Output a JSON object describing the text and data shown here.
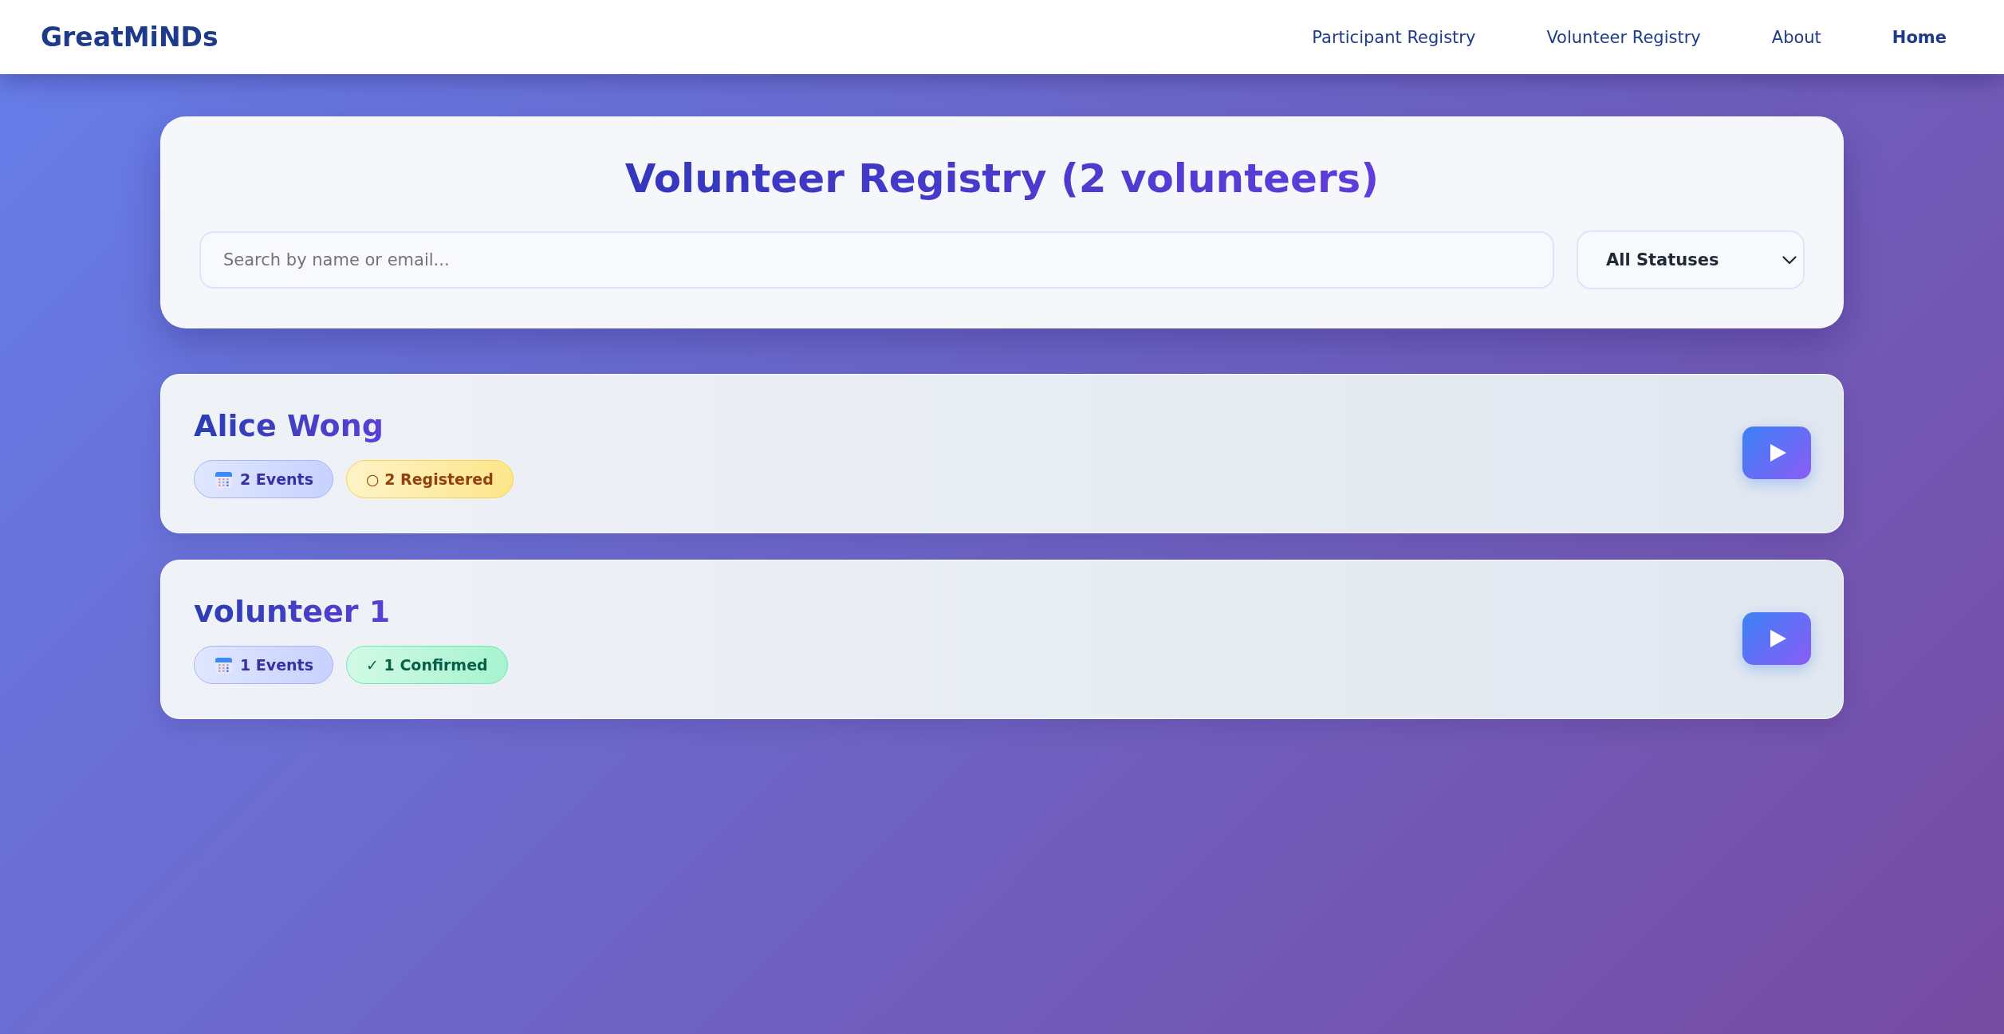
{
  "header": {
    "logo": "GreatMiNDs",
    "nav": [
      {
        "label": "Participant Registry",
        "selected": false
      },
      {
        "label": "Volunteer Registry",
        "selected": false
      },
      {
        "label": "About",
        "selected": false
      },
      {
        "label": "Home",
        "selected": true
      }
    ]
  },
  "registry": {
    "title": "Volunteer Registry (2 volunteers)",
    "search": {
      "placeholder": "Search by name or email..."
    },
    "status_filter": {
      "value": "All Statuses"
    }
  },
  "volunteers": [
    {
      "name": "Alice Wong",
      "events": "2 Events",
      "status": {
        "kind": "registered",
        "label": "○ 2 Registered"
      }
    },
    {
      "name": "volunteer 1",
      "events": "1 Events",
      "status": {
        "kind": "confirmed",
        "label": "✓ 1 Confirmed"
      }
    }
  ]
}
